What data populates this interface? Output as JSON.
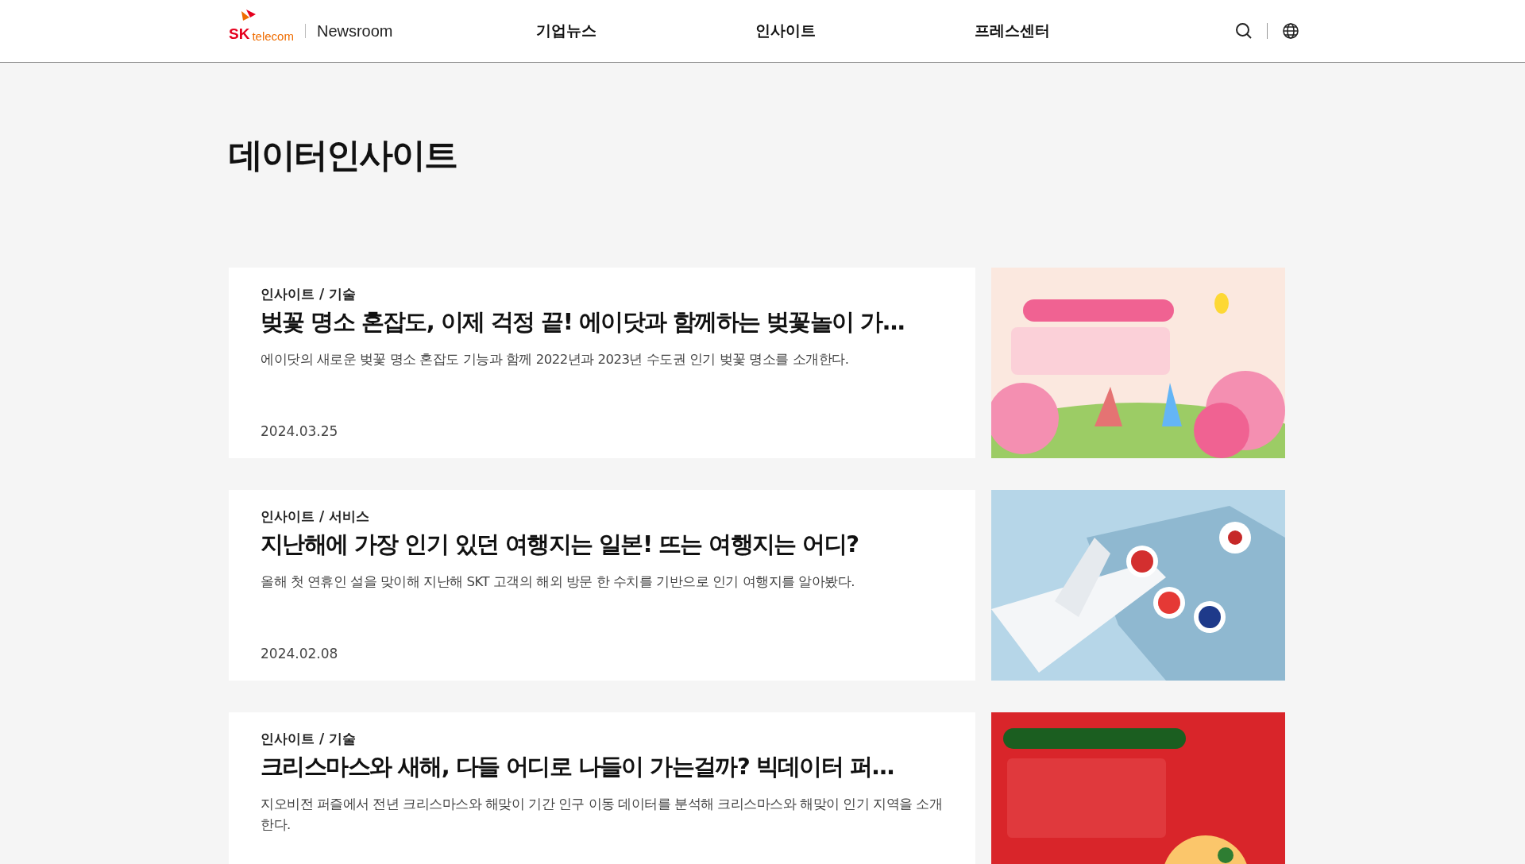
{
  "header": {
    "logo": {
      "brand_sk": "SK",
      "brand_telecom": "telecom",
      "site": "Newsroom"
    },
    "nav": [
      {
        "label": "기업뉴스"
      },
      {
        "label": "인사이트"
      },
      {
        "label": "프레스센터"
      }
    ]
  },
  "page_title": "데이터인사이트",
  "articles": [
    {
      "category": "인사이트 / 기술",
      "title": "벚꽃 명소 혼잡도, 이제 걱정 끝! 에이닷과 함께하는 벚꽃놀이 가...",
      "summary": "에이닷의 새로운 벚꽃 명소 혼잡도 기능과 함께 2022년과 2023년 수도권 인기 벚꽃 명소를 소개한다.",
      "date": "2024.03.25"
    },
    {
      "category": "인사이트 / 서비스",
      "title": "지난해에 가장 인기 있던 여행지는 일본! 뜨는 여행지는 어디?",
      "summary": "올해 첫 연휴인 설을 맞이해 지난해 SKT 고객의 해외 방문 한 수치를 기반으로 인기 여행지를 알아봤다.",
      "date": "2024.02.08"
    },
    {
      "category": "인사이트 / 기술",
      "title": "크리스마스와 새해, 다들 어디로 나들이 가는걸까? 빅데이터 퍼...",
      "summary": "지오비전 퍼즐에서 전년 크리스마스와 해맞이 기간 인구 이동 데이터를 분석해 크리스마스와 해맞이 인기 지역을 소개한다."
    }
  ]
}
